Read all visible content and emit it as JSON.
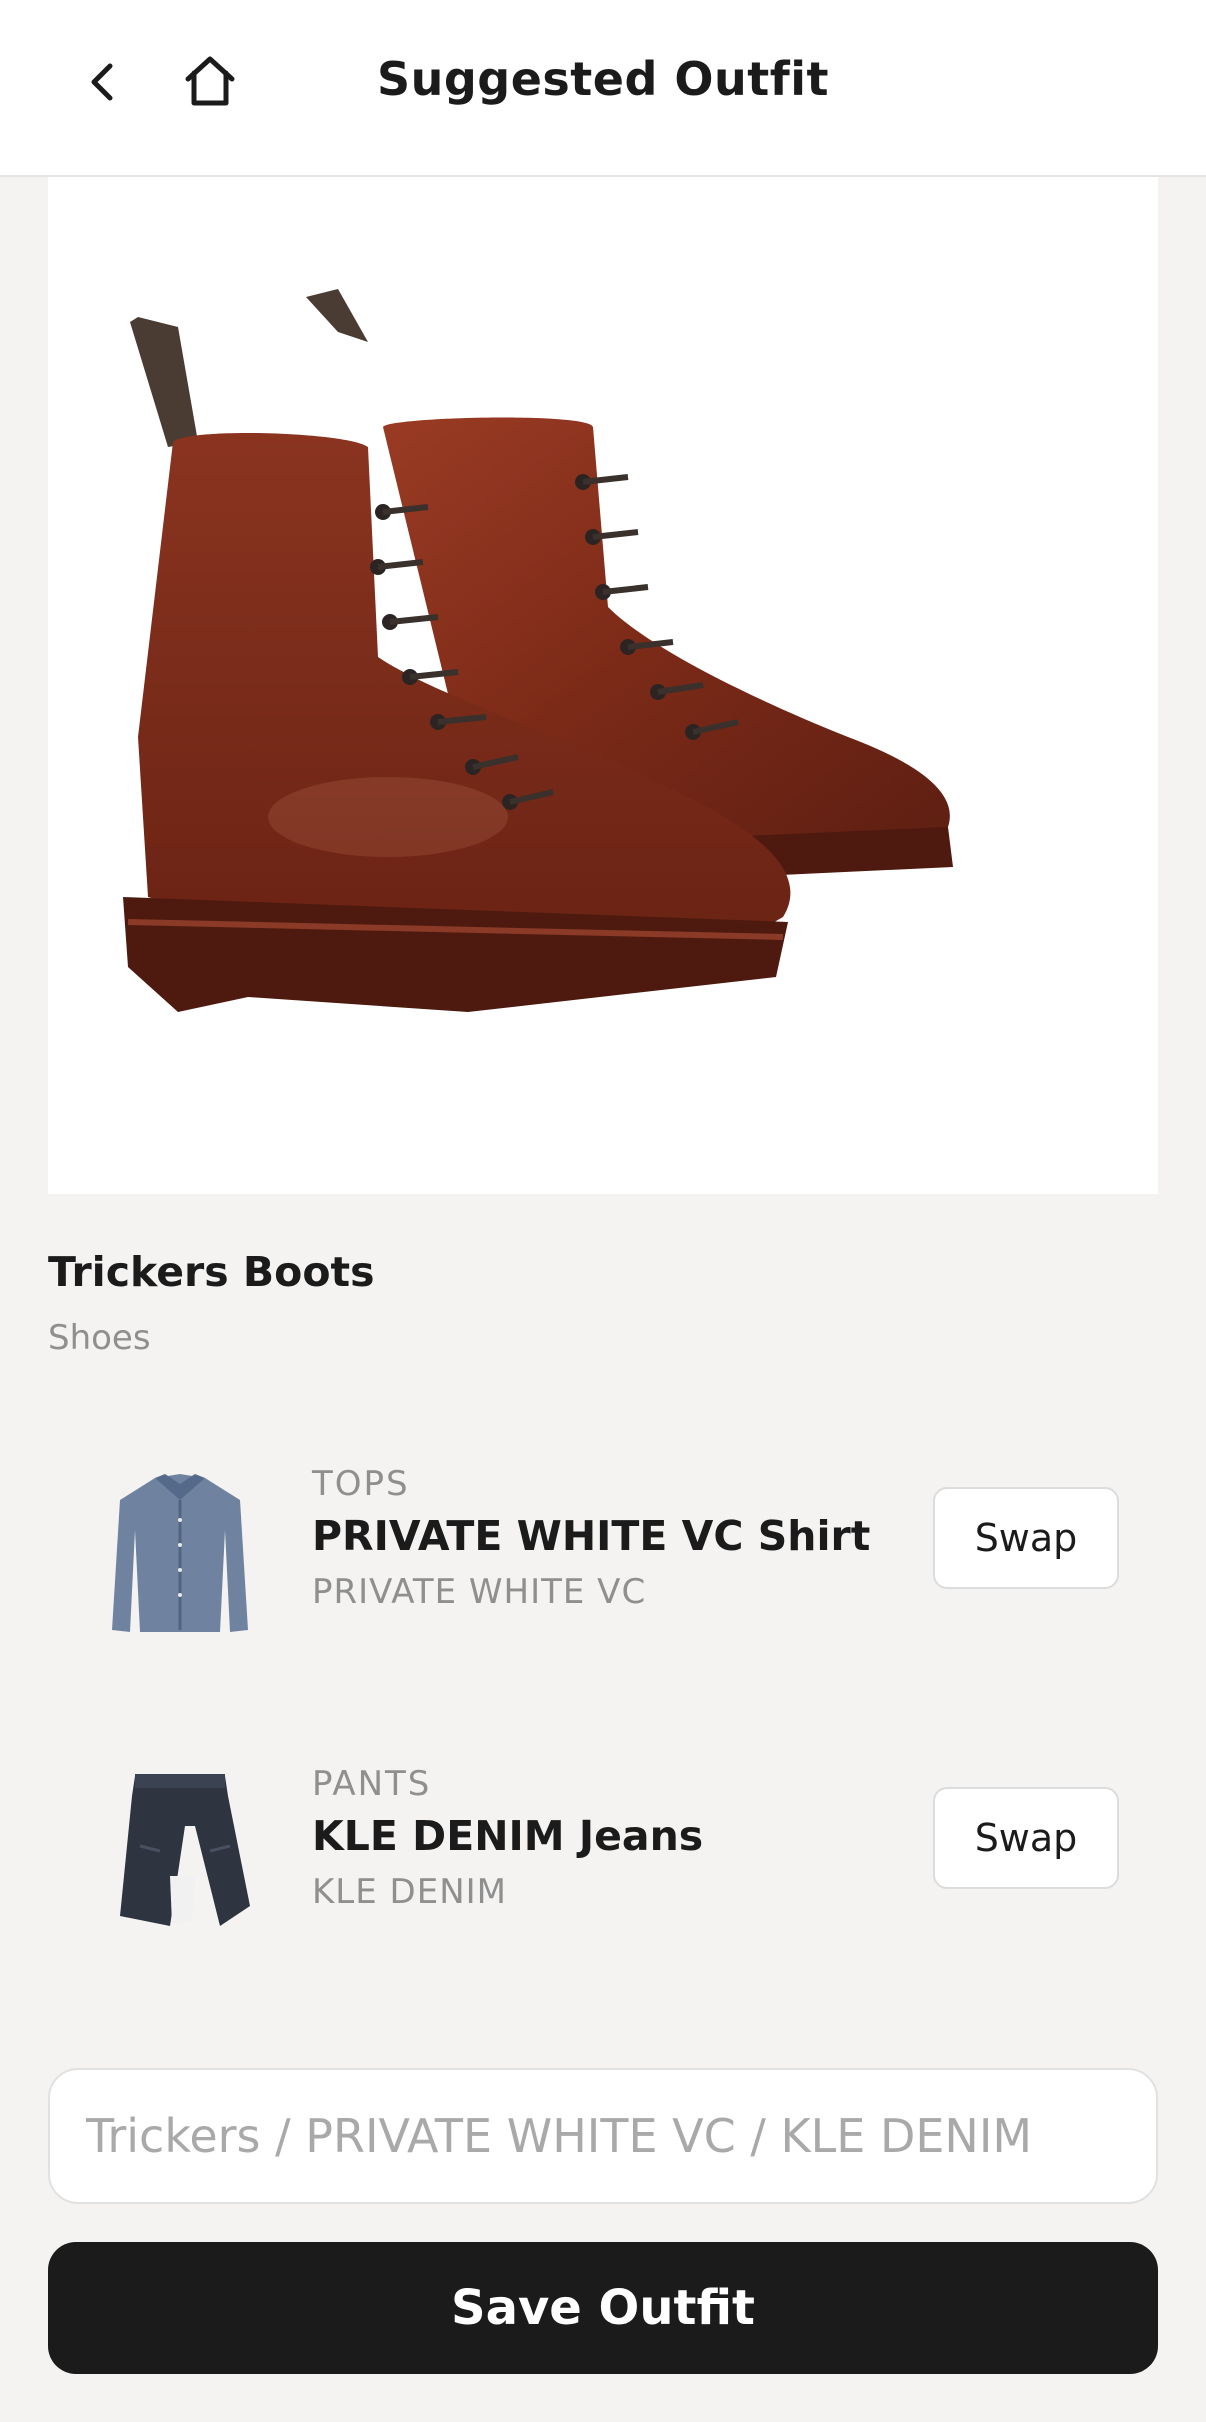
{
  "header": {
    "title": "Suggested Outfit",
    "back_icon": "chevron-left-icon",
    "home_icon": "home-icon"
  },
  "featured": {
    "name": "Trickers Boots",
    "category": "Shoes",
    "image": "brown-leather-boots"
  },
  "items": [
    {
      "category": "TOPS",
      "name": "PRIVATE WHITE VC Shirt",
      "brand": "PRIVATE WHITE VC",
      "swap_label": "Swap",
      "image": "blue-button-shirt"
    },
    {
      "category": "PANTS",
      "name": "KLE DENIM Jeans",
      "brand": "KLE DENIM",
      "swap_label": "Swap",
      "image": "dark-denim-jeans"
    }
  ],
  "outfit_name": {
    "placeholder": "Trickers / PRIVATE WHITE VC / KLE DENIM",
    "value": ""
  },
  "save_label": "Save Outfit",
  "colors": {
    "background": "#f4f3f2",
    "primary_button": "#1b1b1b",
    "muted_text": "#8f8f8f"
  }
}
